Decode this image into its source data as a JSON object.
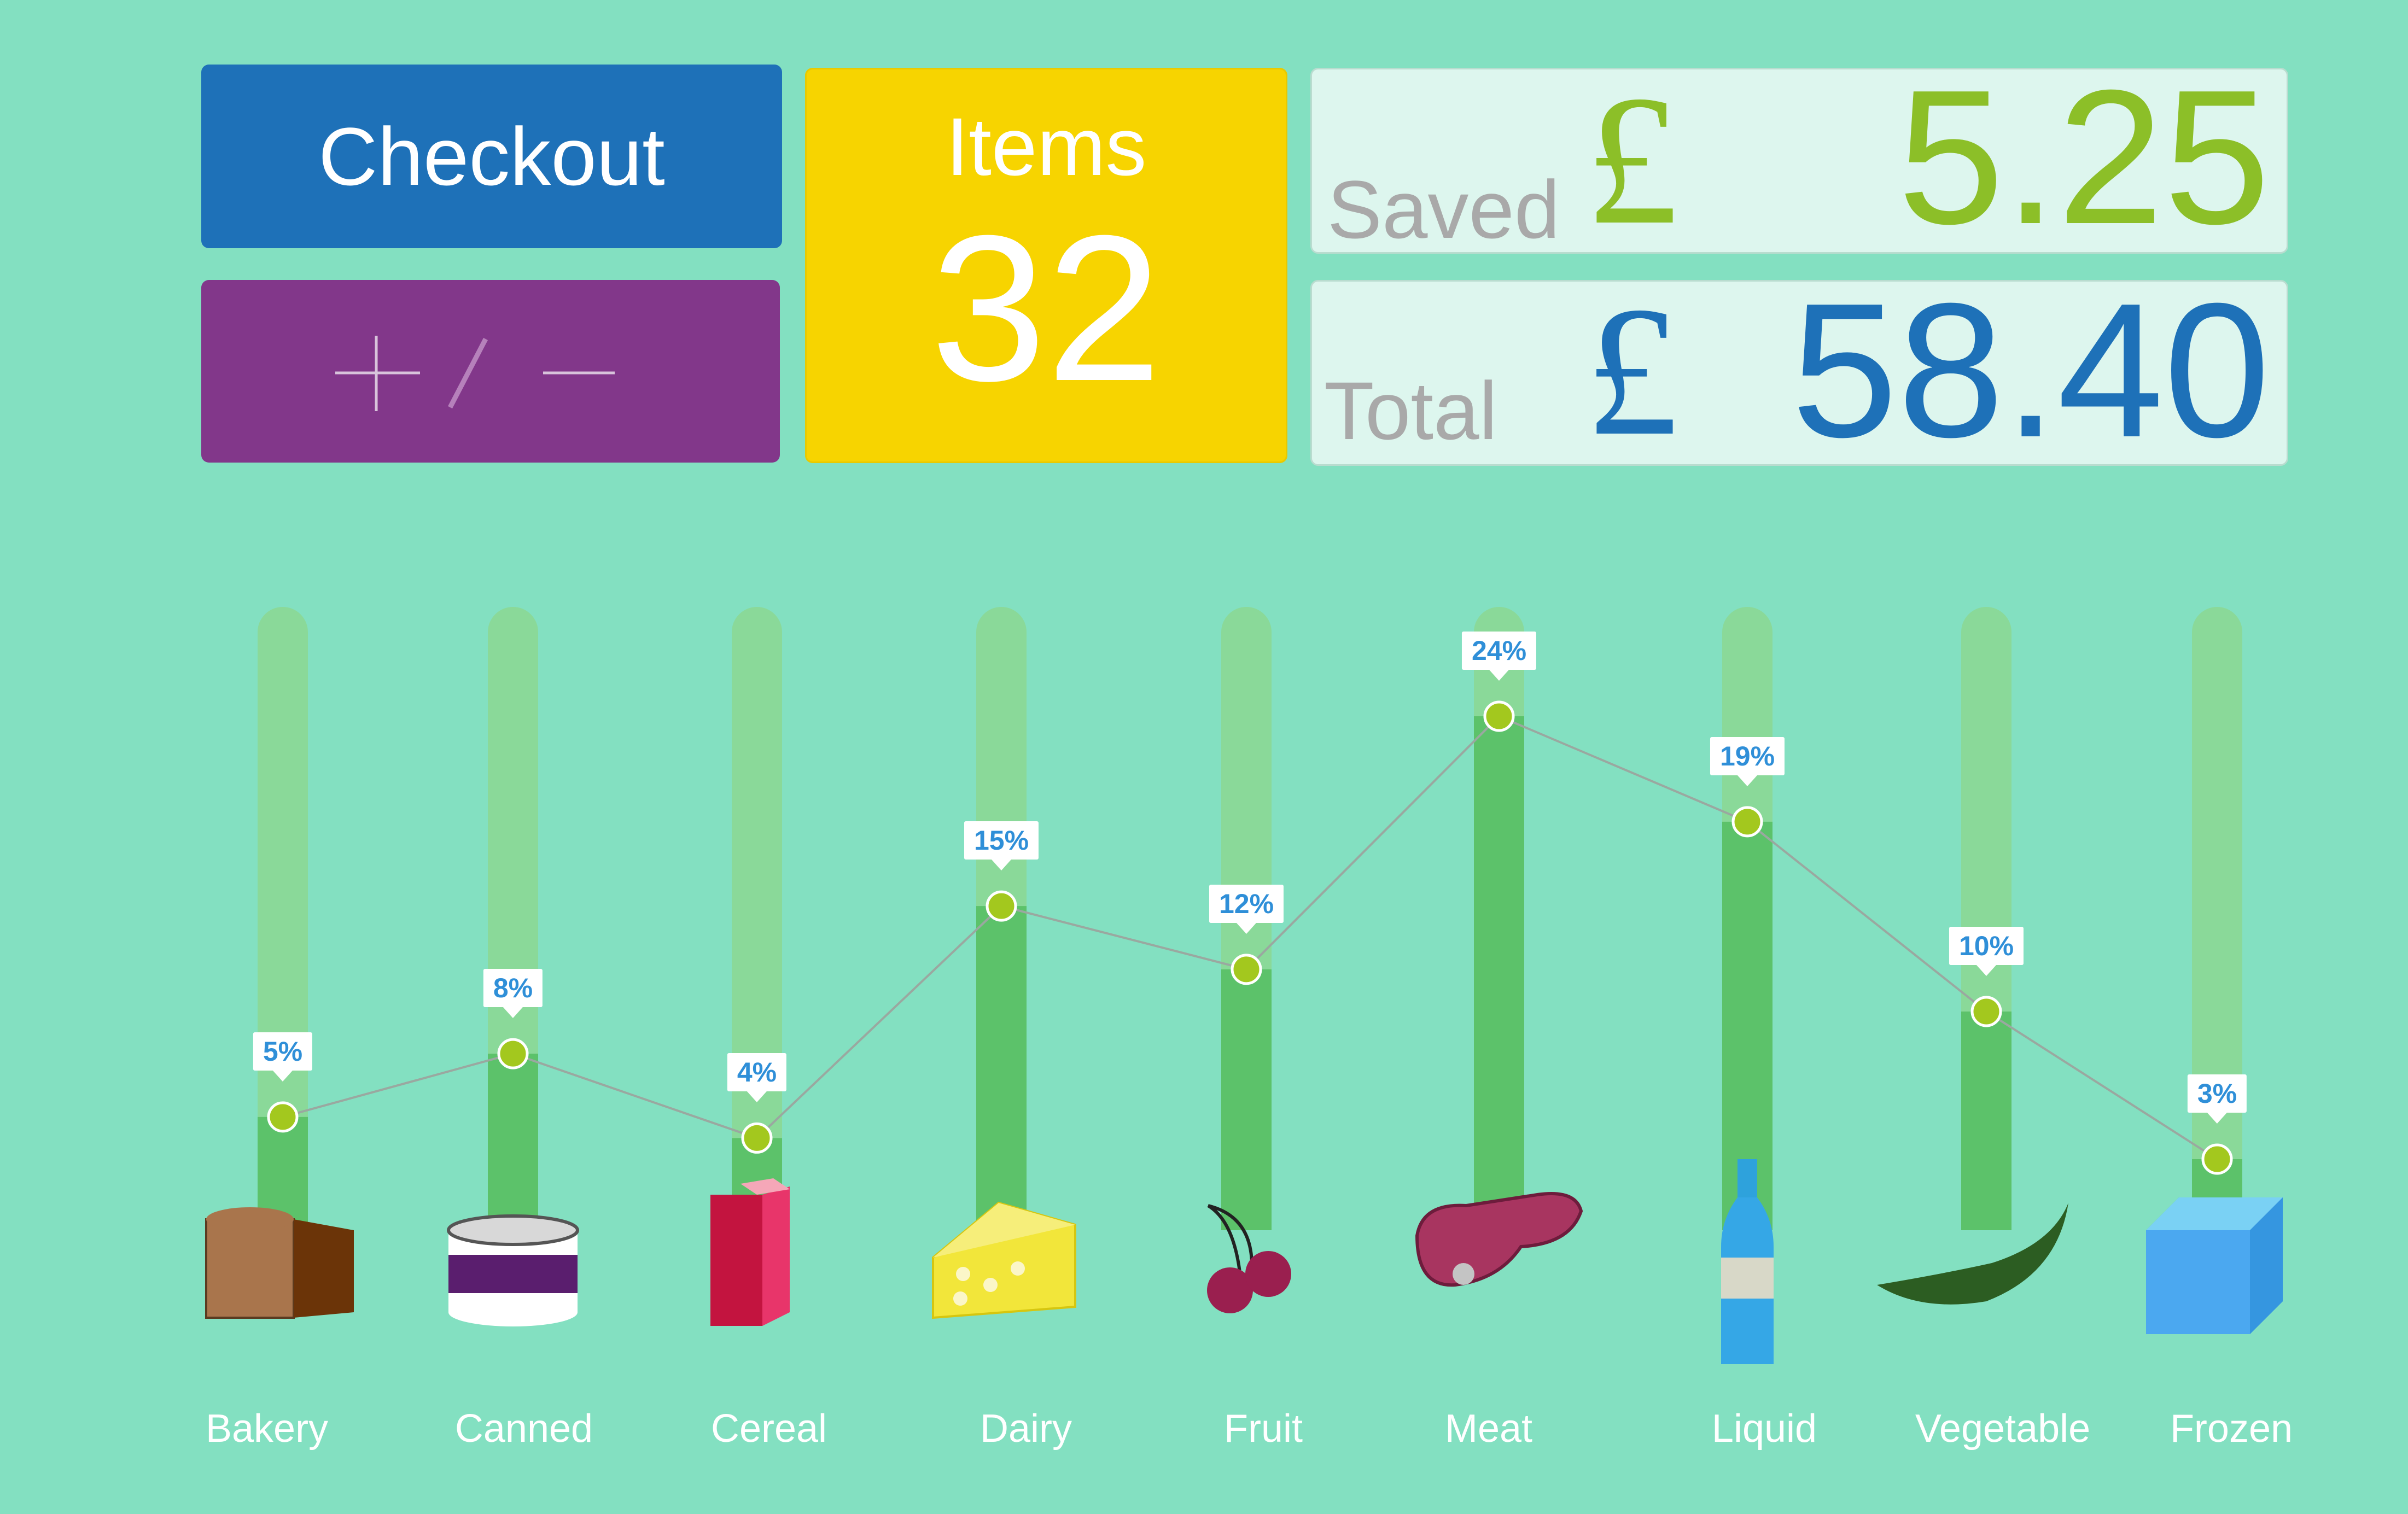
{
  "header": {
    "checkout_label": "Checkout",
    "plus_minus_label": "+ / −",
    "items_label": "Items",
    "items_count": "32",
    "saved_label": "Saved",
    "saved_currency": "£",
    "saved_amount": "5.25",
    "total_label": "Total",
    "total_currency": "£",
    "total_amount": "58.40"
  },
  "colors": {
    "background": "#83e0c1",
    "checkout": "#1e71b8",
    "plus_minus": "#82378a",
    "items": "#f7d400",
    "saved_accent": "#8cbf28",
    "total_accent": "#1e71b8",
    "bar_fill": "#5cc26a",
    "bar_track": "#8ad999",
    "point": "#a3c81e",
    "line": "#9aa8a0"
  },
  "chart_data": {
    "type": "bar",
    "categories": [
      "Bakery",
      "Canned",
      "Cereal",
      "Dairy",
      "Fruit",
      "Meat",
      "Liquid",
      "Vegetable",
      "Frozen"
    ],
    "values": [
      5,
      8,
      4,
      15,
      12,
      24,
      19,
      10,
      3
    ],
    "value_labels": [
      "5%",
      "8%",
      "4%",
      "15%",
      "12%",
      "24%",
      "19%",
      "10%",
      "3%"
    ],
    "icons": [
      "bread-icon",
      "can-icon",
      "cereal-box-icon",
      "cheese-icon",
      "cherry-icon",
      "steak-icon",
      "bottle-icon",
      "pea-pod-icon",
      "ice-cube-icon"
    ],
    "overlay": "line",
    "unit": "%",
    "ylim": [
      0,
      27
    ]
  }
}
